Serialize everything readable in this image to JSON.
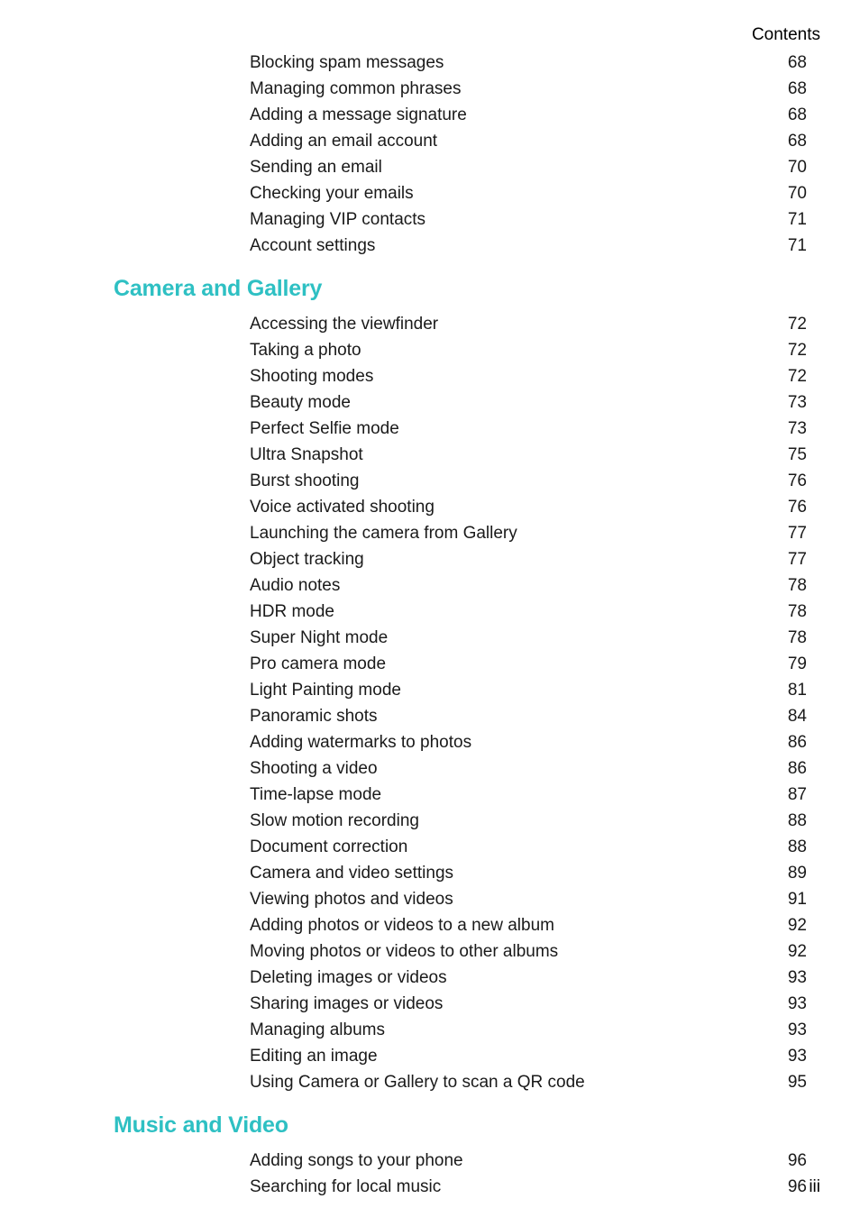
{
  "header": {
    "running_title": "Contents"
  },
  "folio": {
    "page_number": "iii"
  },
  "colors": {
    "heading": "#2ec0c3",
    "body_text": "#1a1a1a",
    "background": "#ffffff"
  },
  "toc": {
    "blocks": [
      {
        "type": "entries",
        "entries": [
          {
            "title": "Blocking spam messages",
            "page": "68"
          },
          {
            "title": "Managing common phrases",
            "page": "68"
          },
          {
            "title": "Adding a message signature",
            "page": "68"
          },
          {
            "title": "Adding an email account",
            "page": "68"
          },
          {
            "title": "Sending an email",
            "page": "70"
          },
          {
            "title": "Checking your emails",
            "page": "70"
          },
          {
            "title": "Managing VIP contacts",
            "page": "71"
          },
          {
            "title": "Account settings",
            "page": "71"
          }
        ]
      },
      {
        "type": "section",
        "heading": "Camera and Gallery",
        "entries": [
          {
            "title": "Accessing the viewfinder",
            "page": "72"
          },
          {
            "title": "Taking a photo",
            "page": "72"
          },
          {
            "title": "Shooting modes",
            "page": "72"
          },
          {
            "title": "Beauty mode",
            "page": "73"
          },
          {
            "title": "Perfect Selfie mode",
            "page": "73"
          },
          {
            "title": "Ultra Snapshot",
            "page": "75"
          },
          {
            "title": "Burst shooting",
            "page": "76"
          },
          {
            "title": "Voice activated shooting",
            "page": "76"
          },
          {
            "title": "Launching the camera from Gallery",
            "page": "77"
          },
          {
            "title": "Object tracking",
            "page": "77"
          },
          {
            "title": "Audio notes",
            "page": "78"
          },
          {
            "title": "HDR mode",
            "page": "78"
          },
          {
            "title": "Super Night mode",
            "page": "78"
          },
          {
            "title": "Pro camera mode",
            "page": "79"
          },
          {
            "title": "Light Painting mode",
            "page": "81"
          },
          {
            "title": "Panoramic shots",
            "page": "84"
          },
          {
            "title": "Adding watermarks to photos",
            "page": "86"
          },
          {
            "title": "Shooting a video",
            "page": "86"
          },
          {
            "title": "Time-lapse mode",
            "page": "87"
          },
          {
            "title": "Slow motion recording",
            "page": "88"
          },
          {
            "title": "Document correction",
            "page": "88"
          },
          {
            "title": "Camera and video settings",
            "page": "89"
          },
          {
            "title": "Viewing photos and videos",
            "page": "91"
          },
          {
            "title": "Adding photos or videos to a new album",
            "page": "92"
          },
          {
            "title": "Moving photos or videos to other albums",
            "page": "92"
          },
          {
            "title": "Deleting images or videos",
            "page": "93"
          },
          {
            "title": "Sharing images or videos",
            "page": "93"
          },
          {
            "title": "Managing albums",
            "page": "93"
          },
          {
            "title": "Editing an image",
            "page": "93"
          },
          {
            "title": "Using Camera or Gallery to scan a QR code",
            "page": "95"
          }
        ]
      },
      {
        "type": "section",
        "heading": "Music and Video",
        "entries": [
          {
            "title": "Adding songs to your phone",
            "page": "96"
          },
          {
            "title": "Searching for local music",
            "page": "96"
          }
        ]
      }
    ]
  }
}
